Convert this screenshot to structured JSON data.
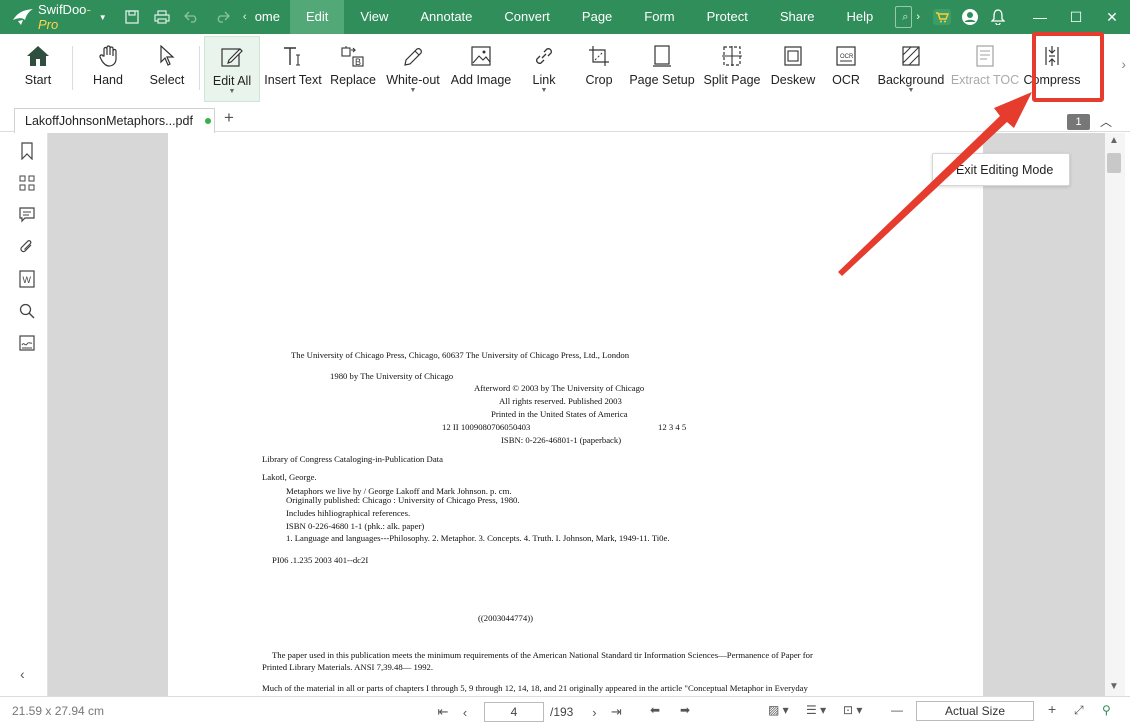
{
  "app": {
    "name_main": "SwifDoo",
    "name_suffix": "-Pro",
    "menu_left_cut": "ome",
    "menu": [
      "Edit",
      "View",
      "Annotate",
      "Convert",
      "Page",
      "Form",
      "Protect",
      "Share",
      "Help"
    ],
    "search_placeholder": "Se",
    "window_controls": [
      "minimize",
      "maximize",
      "close"
    ]
  },
  "ribbon": {
    "tools": [
      {
        "label": "Start",
        "icon": "home-icon"
      },
      {
        "label": "Hand",
        "icon": "hand-icon"
      },
      {
        "label": "Select",
        "icon": "cursor-icon"
      },
      {
        "label": "Edit All",
        "icon": "edit-all-icon",
        "selected": true,
        "dropdown": true
      },
      {
        "label": "Insert Text",
        "icon": "insert-text-icon"
      },
      {
        "label": "Replace",
        "icon": "replace-icon"
      },
      {
        "label": "White-out",
        "icon": "white-out-icon",
        "dropdown": true
      },
      {
        "label": "Add Image",
        "icon": "add-image-icon"
      },
      {
        "label": "Link",
        "icon": "link-icon",
        "dropdown": true
      },
      {
        "label": "Crop",
        "icon": "crop-icon"
      },
      {
        "label": "Page Setup",
        "icon": "page-setup-icon"
      },
      {
        "label": "Split Page",
        "icon": "split-page-icon"
      },
      {
        "label": "Deskew",
        "icon": "deskew-icon"
      },
      {
        "label": "OCR",
        "icon": "ocr-icon"
      },
      {
        "label": "Background",
        "icon": "background-icon",
        "dropdown": true
      },
      {
        "label": "Extract TOC",
        "icon": "extract-toc-icon",
        "disabled": true
      },
      {
        "label": "Compress",
        "icon": "compress-icon",
        "highlighted": true
      }
    ]
  },
  "tabs": {
    "file_name": "LakoffJohnsonMetaphors...pdf",
    "page_badge": "1"
  },
  "document": {
    "exit_button": "Exit Editing Mode",
    "lines": [
      "The University of Chicago Press, Chicago, 60637 The University of Chicago Press, Ltd., London",
      "1980 by The University of Chicago",
      "Afterword © 2003 by The University of Chicago",
      "All rights reserved. Published 2003",
      "Printed in the United States of America",
      "12 II 1009080706050403",
      "12 3 4 5",
      "ISBN: 0-226-46801-1 (paperback)",
      "Library of Congress Cataloging-in-Publication Data",
      "Lakotl, George.",
      "Metaphors we live hy / George Lakoff and Mark Johnson. p. cm.",
      "Originally published: Chicago : University of Chicago Press, 1980.",
      "Includes hihliographical references.",
      "ISBN 0-226-4680 1-1 (phk.: alk. paper)",
      "1. Language and languages---Philosophy. 2. Metaphor. 3. Concepts. 4. Truth. I. Johnson, Mark, 1949-11. Ti0e.",
      "PI06 .1.235 2003 401--dc2I",
      "((2003044774))",
      "The paper used in this publication meets the minimum requirements of the American National Standard tir Information Sciences—Permanence of Paper for",
      "Printed Library Materials. ANSI 7,39.48— 1992.",
      "Much of the material in all or parts of chapters I through 5, 9 through 12, 14, 18, and 21 originally appeared in the article \"Conceptual Metaphor in Everyday"
    ]
  },
  "status": {
    "page_size": "21.59 x 27.94 cm",
    "current_page": "4",
    "total_pages": "/193",
    "zoom": "Actual Size"
  },
  "colors": {
    "brand_green": "#2f8e5a",
    "highlight_red": "#e63c2e"
  }
}
